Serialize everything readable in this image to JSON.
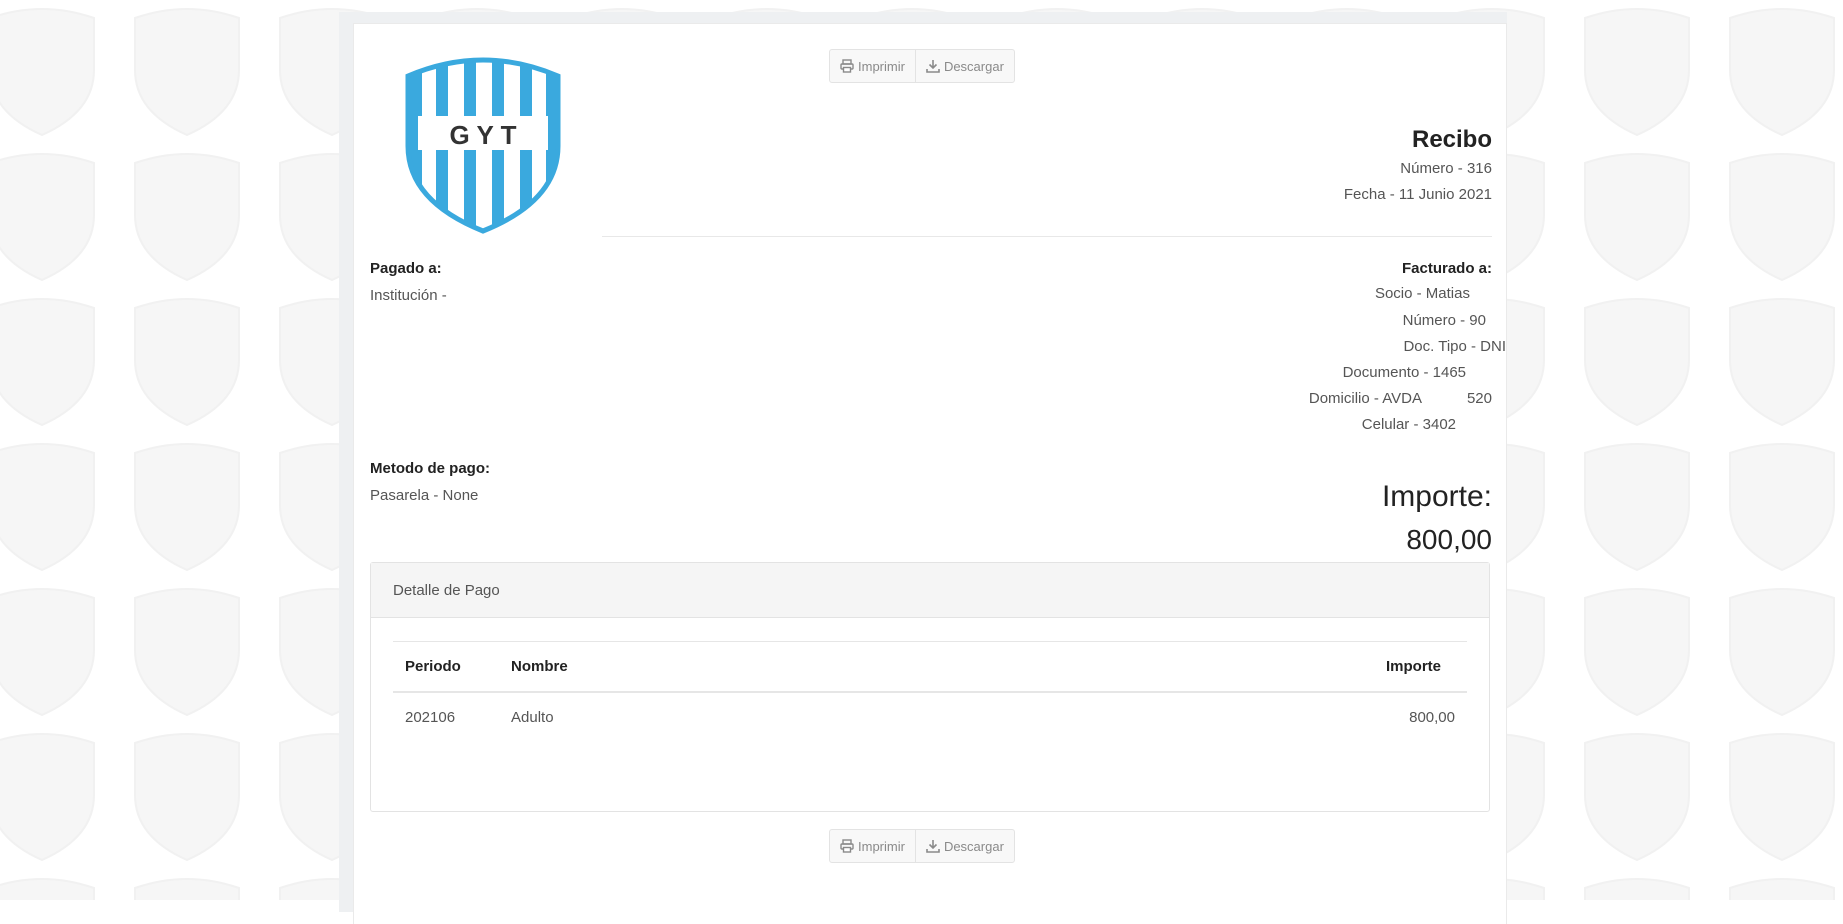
{
  "toolbar": {
    "print_label": "Imprimir",
    "download_label": "Descargar"
  },
  "logo": {
    "text": "G Y T",
    "stripe_color": "#3aa9de"
  },
  "receipt": {
    "title": "Recibo",
    "number": "Número - 316",
    "date": "Fecha - 11 Junio 2021"
  },
  "paid_to": {
    "label": "Pagado a:",
    "institution": "Institución -"
  },
  "billed_to": {
    "label": "Facturado a:",
    "member": "Socio - Matias",
    "number": "Número - 90",
    "doc_type": "Doc. Tipo - DNI",
    "document": "Documento - 1465",
    "address": "Domicilio - AVDA           520",
    "phone": "Celular - 3402"
  },
  "payment_method": {
    "label": "Metodo de pago:",
    "value": "Pasarela - None"
  },
  "amount": {
    "label": "Importe:",
    "value": "800,00"
  },
  "detail": {
    "title": "Detalle de Pago",
    "columns": [
      "Periodo",
      "Nombre",
      "Importe"
    ],
    "rows": [
      {
        "period": "202106",
        "name": "Adulto",
        "amount": "800,00"
      }
    ]
  }
}
